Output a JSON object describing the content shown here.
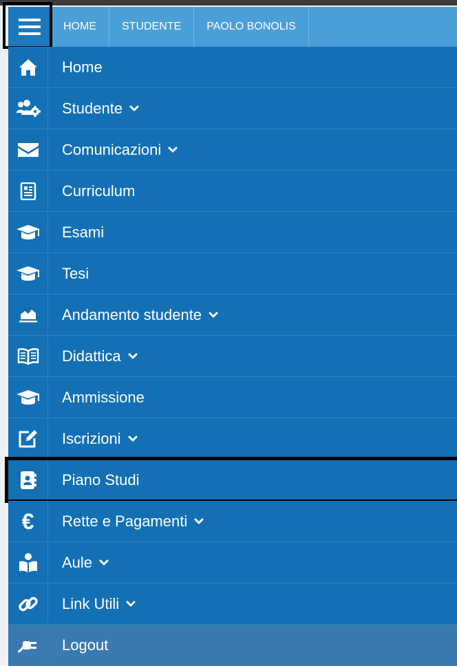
{
  "breadcrumbs": [
    "HOME",
    "STUDENTE",
    "PAOLO BONOLIS"
  ],
  "menu": [
    {
      "label": "Home",
      "icon": "home-icon",
      "submenu": false
    },
    {
      "label": "Studente",
      "icon": "users-gear-icon",
      "submenu": true
    },
    {
      "label": "Comunicazioni",
      "icon": "envelope-icon",
      "submenu": true
    },
    {
      "label": "Curriculum",
      "icon": "document-icon",
      "submenu": false
    },
    {
      "label": "Esami",
      "icon": "graduation-cap-icon",
      "submenu": false
    },
    {
      "label": "Tesi",
      "icon": "graduation-cap-icon",
      "submenu": false
    },
    {
      "label": "Andamento studente",
      "icon": "area-chart-icon",
      "submenu": true
    },
    {
      "label": "Didattica",
      "icon": "open-book-icon",
      "submenu": true
    },
    {
      "label": "Ammissione",
      "icon": "graduation-cap-icon",
      "submenu": false
    },
    {
      "label": "Iscrizioni",
      "icon": "edit-icon",
      "submenu": true
    },
    {
      "label": "Piano Studi",
      "icon": "address-book-icon",
      "submenu": false
    },
    {
      "label": "Rette e Pagamenti",
      "icon": "euro-icon",
      "submenu": true
    },
    {
      "label": "Aule",
      "icon": "reader-icon",
      "submenu": true
    },
    {
      "label": "Link Utili",
      "icon": "link-icon",
      "submenu": true
    },
    {
      "label": "Logout",
      "icon": "plug-icon",
      "submenu": false
    }
  ],
  "colors": {
    "menu_bg": "#1370b5",
    "topbar_bg": "#4a9fd8",
    "logout_bg": "#3a7ab0"
  }
}
